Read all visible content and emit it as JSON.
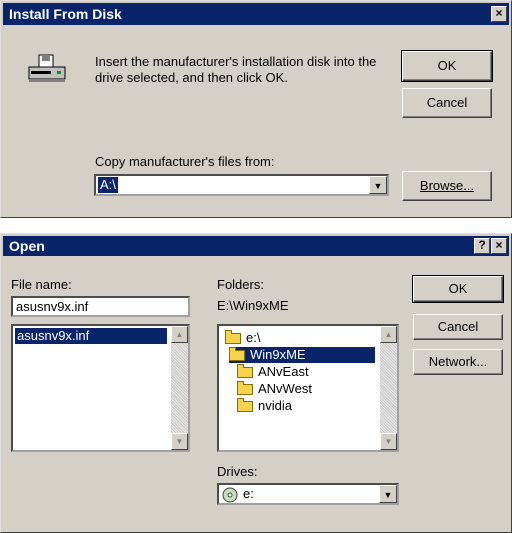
{
  "install_dialog": {
    "title": "Install From Disk",
    "close_glyph": "×",
    "message": "Insert the manufacturer's installation disk into the drive selected, and then click OK.",
    "ok_label": "OK",
    "cancel_label": "Cancel",
    "copy_label": "Copy manufacturer's files from:",
    "copy_value": "A:\\",
    "browse_label": "Browse..."
  },
  "open_dialog": {
    "title": "Open",
    "help_glyph": "?",
    "close_glyph": "×",
    "file_name_label": "File name:",
    "file_name_value": "asusnv9x.inf",
    "files": [
      "asusnv9x.inf"
    ],
    "folders_label": "Folders:",
    "current_path": "E:\\Win9xME",
    "folder_tree": [
      "e:\\",
      "Win9xME",
      "ANvEast",
      "ANvWest",
      "nvidia"
    ],
    "drives_label": "Drives:",
    "drive_value": "e:",
    "ok_label": "OK",
    "cancel_label": "Cancel",
    "network_label": "Network..."
  }
}
